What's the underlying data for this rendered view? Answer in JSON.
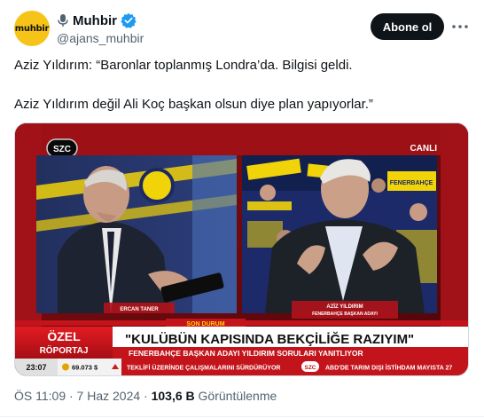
{
  "author": {
    "display_name": "Muhbir",
    "handle": "@ajans_muhbir",
    "avatar_text": "muhbir"
  },
  "actions": {
    "subscribe_label": "Abone ol"
  },
  "tweet": {
    "line1": "Aziz Yıldırım: “Baronlar toplanmış Londra’da. Bilgisi geldi.",
    "line2": "Aziz Yıldırım değil Ali Koç başkan olsun diye plan yapıyorlar.”"
  },
  "media": {
    "channel_logo": "SZC",
    "live_label": "CANLI",
    "left_caption": "ERCAN TANER",
    "right_caption_name": "AZİZ YILDIRIM",
    "right_caption_title": "FENERBAHÇE BAŞKAN ADAYI",
    "breaking_label": "SON DURUM",
    "program_line1": "ÖZEL",
    "program_line2": "RÖPORTAJ",
    "headline": "\"KULÜBÜN KAPISINDA BEKÇİLİĞE RAZIYIM\"",
    "subheadline": "FENERBAHÇE BAŞKAN ADAYI YILDIRIM SORULARI YANITLIYOR",
    "clock": "23:07",
    "ticker_value": "69.073 $",
    "ticker_left": "TEKLİFİ ÜZERİNDE ÇALIŞMALARINI SÜRDÜRÜYOR",
    "ticker_logo": "SZC",
    "ticker_right": "ABD'DE TARIM DIŞI İSTİHDAM MAYISTA 27"
  },
  "meta": {
    "time": "ÖS 11:09 · 7 Haz 2024 · ",
    "views": "103,6 B",
    "views_label": " Görüntülenme"
  },
  "colors": {
    "accent": "#1d9bf0",
    "brand_red": "#c4141b",
    "fener_yellow": "#f1d30a",
    "fener_navy": "#1b2a63"
  }
}
